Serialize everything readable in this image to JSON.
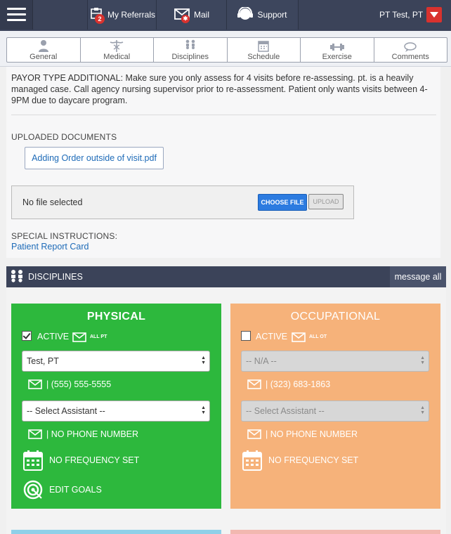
{
  "nav": {
    "referrals_label": "My Referrals",
    "referrals_badge": "2",
    "mail_label": "Mail",
    "mail_badge": "✱",
    "support_label": "Support",
    "user_name": "PT Test, PT"
  },
  "tabs": [
    {
      "label": "General",
      "icon": "person-icon"
    },
    {
      "label": "Medical",
      "icon": "caduceus-icon"
    },
    {
      "label": "Disciplines",
      "icon": "people-icon"
    },
    {
      "label": "Schedule",
      "icon": "calendar-icon"
    },
    {
      "label": "Exercise",
      "icon": "exercise-icon"
    },
    {
      "label": "Comments",
      "icon": "chat-icon"
    }
  ],
  "content": {
    "payor_text": "PAYOR TYPE ADDITIONAL: Make sure you only assess for 4 visits before re-assessing. pt. is a heavily managed case. Call agency nursing supervisor prior to re-assessment. Patient only wants visits between 4-9PM due to daycare program.",
    "uploaded_label": "UPLOADED DOCUMENTS",
    "document_name": "Adding Order outside of visit.pdf",
    "file_status": "No file selected",
    "choose_label": "CHOOSE FILE",
    "upload_label": "UPLOAD",
    "special_label": "SPECIAL INSTRUCTIONS:",
    "special_link": "Patient Report Card"
  },
  "disciplines": {
    "title": "DISCIPLINES",
    "message_all": "message all",
    "cards": [
      {
        "title": "PHYSICAL",
        "active_label": "ACTIVE",
        "active": true,
        "all_label": "ALL PT",
        "therapist": "Test, PT",
        "therapist_phone": "| (555) 555-5555",
        "assistant": "-- Select Assistant --",
        "assistant_phone": "| NO PHONE NUMBER",
        "frequency": "NO FREQUENCY SET",
        "goals": "EDIT GOALS",
        "color": "#2db83d"
      },
      {
        "title": "OCCUPATIONAL",
        "active_label": "ACTIVE",
        "active": false,
        "all_label": "ALL OT",
        "therapist": "-- N/A --",
        "therapist_phone": "| (323) 683-1863",
        "assistant": "-- Select Assistant --",
        "assistant_phone": "| NO PHONE NUMBER",
        "frequency": "NO FREQUENCY SET",
        "color": "#f6b27a"
      }
    ]
  }
}
